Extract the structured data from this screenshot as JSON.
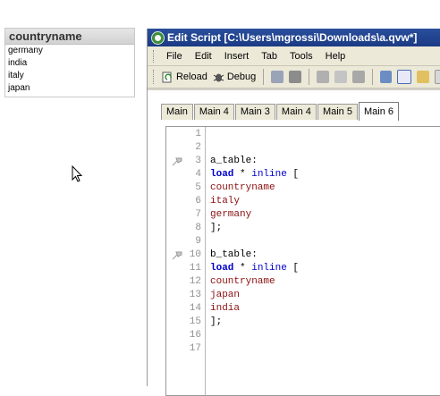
{
  "listbox": {
    "title": "countryname",
    "items": [
      "germany",
      "india",
      "italy",
      "japan"
    ]
  },
  "window": {
    "title": "Edit Script [C:\\Users\\mgrossi\\Downloads\\a.qvw*]"
  },
  "menu": [
    "File",
    "Edit",
    "Insert",
    "Tab",
    "Tools",
    "Help"
  ],
  "toolbar": {
    "reload_label": "Reload",
    "debug_label": "Debug"
  },
  "tabs": [
    "Main",
    "Main 4",
    "Main 3",
    "Main 4",
    "Main 5",
    "Main 6"
  ],
  "active_tab": "Main 6",
  "editor": {
    "line_numbers": [
      "1",
      "2",
      "3",
      "4",
      "5",
      "6",
      "7",
      "8",
      "9",
      "10",
      "11",
      "12",
      "13",
      "14",
      "15",
      "16",
      "17"
    ],
    "lines": {
      "l3": "a_table:",
      "l4_kw": "load",
      "l4_mid": " * ",
      "l4_kw2": "inline",
      "l4_end": " [",
      "l5": "countryname",
      "l6": "italy",
      "l7": "germany",
      "l8": "];",
      "l10": "b_table:",
      "l11_kw": "load",
      "l11_mid": " * ",
      "l11_kw2": "inline",
      "l11_end": " [",
      "l12": "countryname",
      "l13": "japan",
      "l14": "india",
      "l15": "];"
    }
  }
}
